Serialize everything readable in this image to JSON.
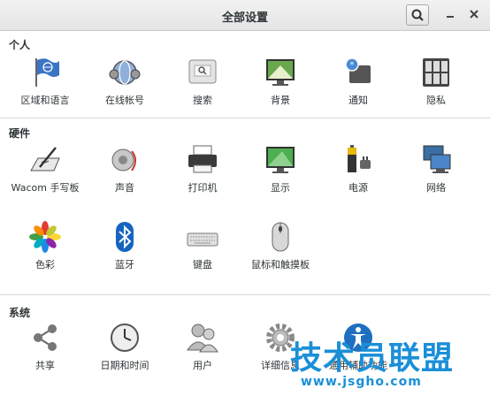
{
  "window": {
    "title": "全部设置"
  },
  "sections": {
    "personal": {
      "title": "个人",
      "items": [
        {
          "label": "区域和语言",
          "icon": "flag-globe-icon"
        },
        {
          "label": "在线帐号",
          "icon": "online-accounts-icon"
        },
        {
          "label": "搜索",
          "icon": "search-settings-icon"
        },
        {
          "label": "背景",
          "icon": "background-icon"
        },
        {
          "label": "通知",
          "icon": "notifications-icon"
        },
        {
          "label": "隐私",
          "icon": "privacy-icon"
        }
      ]
    },
    "hardware": {
      "title": "硬件",
      "items": [
        {
          "label": "Wacom 手写板",
          "icon": "wacom-tablet-icon"
        },
        {
          "label": "声音",
          "icon": "sound-icon"
        },
        {
          "label": "打印机",
          "icon": "printer-icon"
        },
        {
          "label": "显示",
          "icon": "display-icon"
        },
        {
          "label": "电源",
          "icon": "power-icon"
        },
        {
          "label": "网络",
          "icon": "network-icon"
        },
        {
          "label": "色彩",
          "icon": "color-icon"
        },
        {
          "label": "蓝牙",
          "icon": "bluetooth-icon"
        },
        {
          "label": "键盘",
          "icon": "keyboard-icon"
        },
        {
          "label": "鼠标和触摸板",
          "icon": "mouse-icon"
        }
      ]
    },
    "system": {
      "title": "系统",
      "items": [
        {
          "label": "共享",
          "icon": "sharing-icon"
        },
        {
          "label": "日期和时间",
          "icon": "clock-icon"
        },
        {
          "label": "用户",
          "icon": "users-icon"
        },
        {
          "label": "详细信息",
          "icon": "details-gear-icon"
        },
        {
          "label": "通用辅助功能",
          "icon": "universal-access-icon"
        }
      ]
    }
  },
  "watermark": {
    "text": "技术员联盟",
    "url": "www.jsgho.com"
  },
  "colors": {
    "accent": "#1a8fd8",
    "titlebar": "#e8e8e8"
  }
}
